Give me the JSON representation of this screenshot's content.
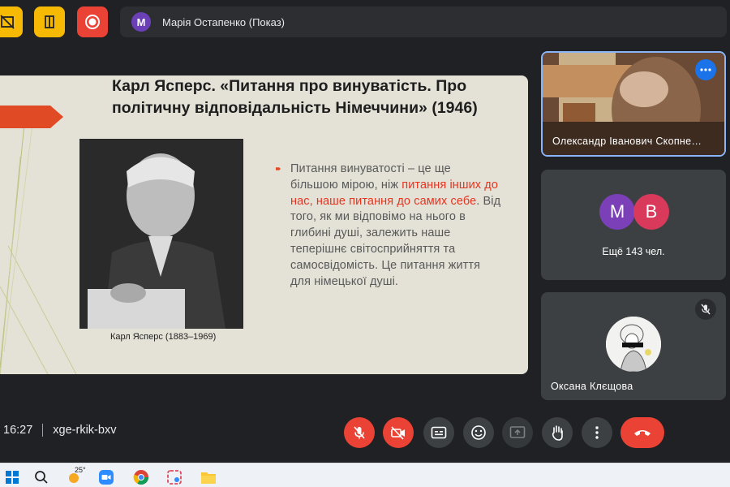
{
  "top_bar": {
    "presenter_avatar_letter": "M",
    "presenter_name": "Марія Остапенко (Показ)"
  },
  "slide": {
    "title": "Карл Ясперс. «Питання про винуватість. Про політичну відповідальність Німеччини» (1946)",
    "photo_caption": "Карл Ясперс (1883–1969)",
    "body_part1": "Питання винуватості – це ще більшою мірою, ніж ",
    "body_highlight": "питання інших до нас, наше питання до самих себе",
    "body_part2": ". Від того, як ми відповімо на нього в глибині душі, залежить наше теперішнє світосприйняття та самосвідомість. Це питання життя для німецької душі."
  },
  "participants": {
    "video_tile_name": "Олександр Іванович Скопне…",
    "more": {
      "avatars": [
        {
          "letter": "M",
          "color": "#7b3fb8"
        },
        {
          "letter": "B",
          "color": "#d93a5c"
        }
      ],
      "label": "Ещё 143 чел."
    },
    "oksana_name": "Оксана Клєщова"
  },
  "meeting": {
    "time": "16:27",
    "code": "xge-rkik-bxv"
  },
  "taskbar": {
    "weather_temp": "25°"
  },
  "colors": {
    "accent_red": "#ea4335",
    "tile_bg": "#3c4043",
    "page_bg": "#202124",
    "yellow_btn": "#f6b904"
  }
}
